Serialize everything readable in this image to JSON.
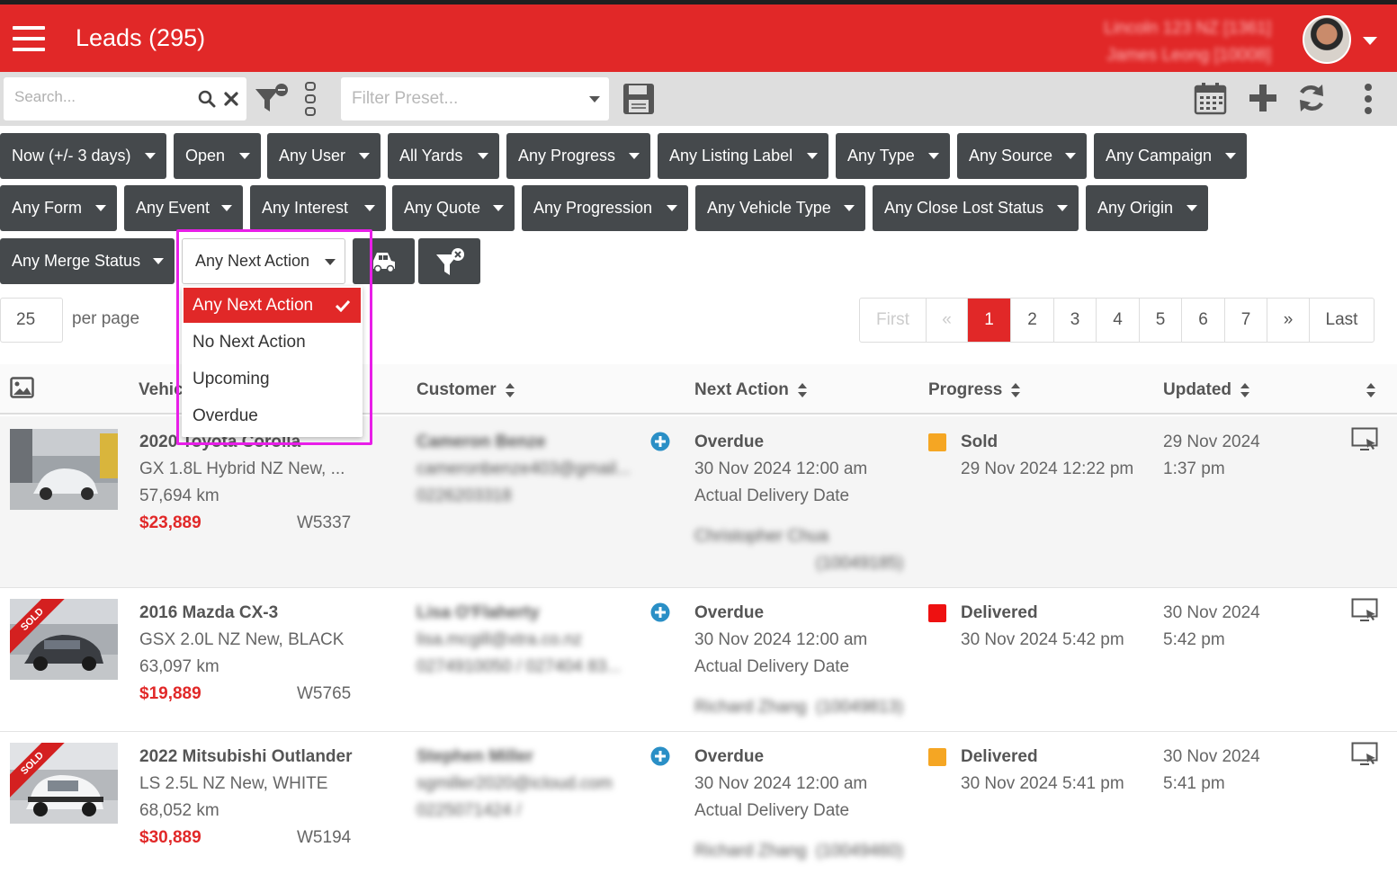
{
  "header": {
    "title": "Leads (295)",
    "user_line1": "Lincoln 123 NZ [1361]",
    "user_line2": "James Leong [10008]"
  },
  "toolbar": {
    "search_placeholder": "Search...",
    "preset_placeholder": "Filter Preset..."
  },
  "filters": {
    "row1": [
      "Now (+/- 3 days)",
      "Open",
      "Any User",
      "All Yards",
      "Any Progress",
      "Any Listing Label",
      "Any Type",
      "Any Source",
      "Any Campaign"
    ],
    "row2": [
      "Any Form",
      "Any Event",
      "Any Interest",
      "Any Quote",
      "Any Progression",
      "Any Vehicle Type",
      "Any Close Lost Status",
      "Any Origin"
    ],
    "merge_status": "Any Merge Status",
    "next_action": "Any Next Action"
  },
  "dropdown": {
    "items": [
      "Any Next Action",
      "No Next Action",
      "Upcoming",
      "Overdue"
    ],
    "selected": "Any Next Action"
  },
  "per_page": {
    "value": "25",
    "label": "per page"
  },
  "pagination": [
    "First",
    "«",
    "1",
    "2",
    "3",
    "4",
    "5",
    "6",
    "7",
    "»",
    "Last"
  ],
  "columns": [
    "Vehicle",
    "Customer",
    "Next Action",
    "Progress",
    "Updated"
  ],
  "rows": [
    {
      "vehicle_title": "2020 Toyota Corolla",
      "vehicle_desc": "GX 1.8L Hybrid NZ New, ...",
      "km": "57,694 km",
      "price": "$23,889",
      "stock": "W5337",
      "customer_name": "Cameron Benze",
      "customer_email": "cameronbenze403@gmail...",
      "customer_phone": "0226203318",
      "next_action_status": "Overdue",
      "next_action_date": "30 Nov 2024 12:00 am",
      "next_action_type": "Actual Delivery Date",
      "assignee": "Christopher Chua",
      "assignee_id": "(10049185)",
      "progress_status": "Sold",
      "progress_date": "29 Nov 2024 12:22 pm",
      "progress_color": "#f5a623",
      "updated_date": "29 Nov 2024",
      "updated_time": "1:37 pm",
      "sold": false
    },
    {
      "vehicle_title": "2016 Mazda CX-3",
      "vehicle_desc": "GSX 2.0L NZ New, BLACK",
      "km": "63,097 km",
      "price": "$19,889",
      "stock": "W5765",
      "customer_name": "Lisa O'Flaherty",
      "customer_email": "lisa.mcgill@xtra.co.nz",
      "customer_phone": "0274910050 / 027404 83...",
      "next_action_status": "Overdue",
      "next_action_date": "30 Nov 2024 12:00 am",
      "next_action_type": "Actual Delivery Date",
      "assignee": "Richard Zhang",
      "assignee_id": "(10049813)",
      "progress_status": "Delivered",
      "progress_date": "30 Nov 2024 5:42 pm",
      "progress_color": "#ee1111",
      "updated_date": "30 Nov 2024",
      "updated_time": "5:42 pm",
      "sold": true
    },
    {
      "vehicle_title": "2022 Mitsubishi Outlander",
      "vehicle_desc": "LS 2.5L NZ New, WHITE",
      "km": "68,052 km",
      "price": "$30,889",
      "stock": "W5194",
      "customer_name": "Stephen Miller",
      "customer_email": "sgmiller2020@icloud.com",
      "customer_phone": "0225071424 /",
      "next_action_status": "Overdue",
      "next_action_date": "30 Nov 2024 12:00 am",
      "next_action_type": "Actual Delivery Date",
      "assignee": "Richard Zhang",
      "assignee_id": "(10049460)",
      "progress_status": "Delivered",
      "progress_date": "30 Nov 2024 5:41 pm",
      "progress_color": "#f5a623",
      "updated_date": "30 Nov 2024",
      "updated_time": "5:41 pm",
      "sold": true
    }
  ],
  "sold_label": "SOLD",
  "colors": {
    "brand_red": "#e12828",
    "dark_button": "#45494c",
    "highlight": "#e81ee8",
    "plus_blue": "#2a8fc6"
  }
}
